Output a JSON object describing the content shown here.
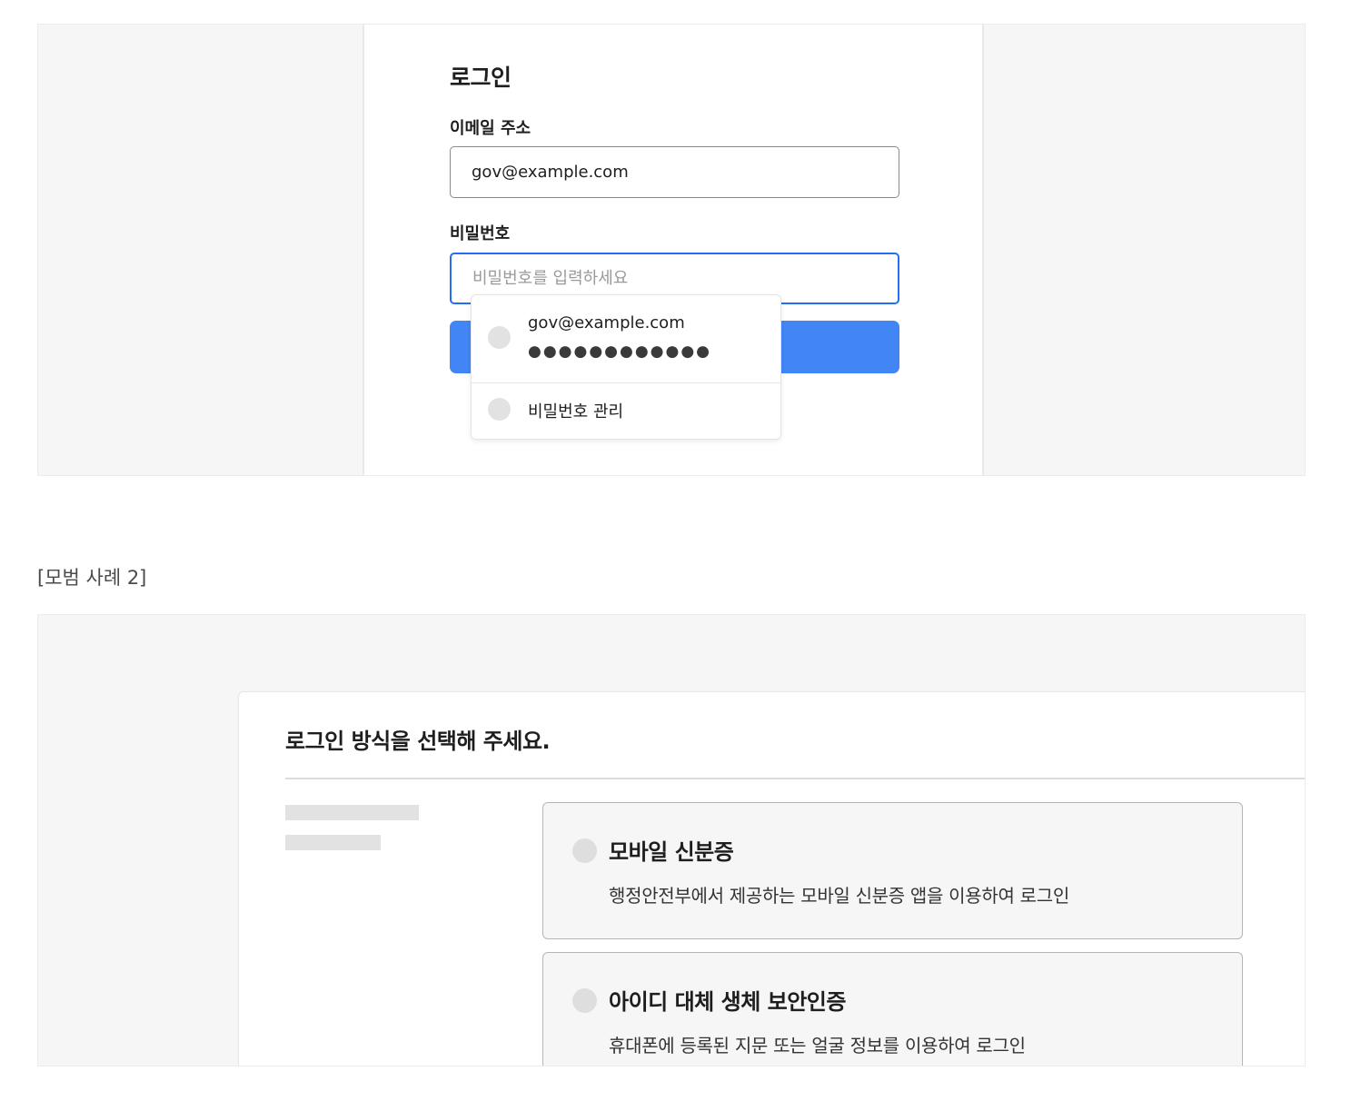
{
  "example1": {
    "title": "로그인",
    "email_label": "이메일 주소",
    "email_value": "gov@example.com",
    "password_label": "비밀번호",
    "password_placeholder": "비밀번호를 입력하세요",
    "autofill": {
      "account_email": "gov@example.com",
      "account_password_mask": "●●●●●●●●●●●●",
      "manage_label": "비밀번호 관리"
    }
  },
  "caption": "[모범 사례 2]",
  "example2": {
    "title": "로그인 방식을 선택해 주세요.",
    "options": [
      {
        "title": "모바일 신분증",
        "description": "행정안전부에서 제공하는 모바일 신분증 앱을 이용하여 로그인"
      },
      {
        "title": "아이디 대체 생체 보안인증",
        "description": "휴대폰에 등록된 지문 또는 얼굴 정보를 이용하여 로그인"
      }
    ]
  },
  "colors": {
    "primary": "#256ef4",
    "button": "#4286f6",
    "frame_bg": "#f6f6f6"
  }
}
